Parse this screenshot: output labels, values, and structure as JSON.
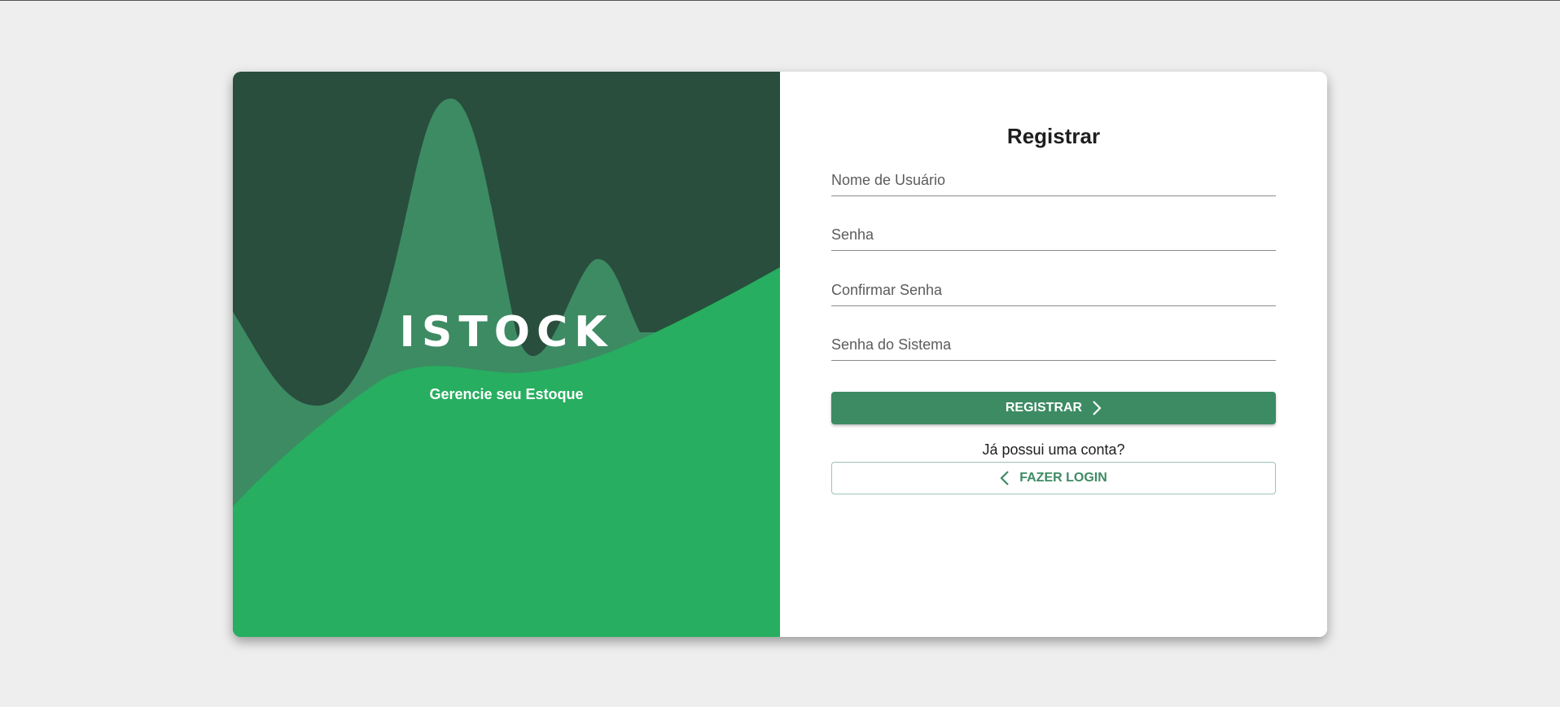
{
  "brand": {
    "name": "ISTOCK",
    "tagline": "Gerencie seu Estoque"
  },
  "form": {
    "title": "Registrar",
    "fields": [
      {
        "placeholder": "Nome de Usuário",
        "value": ""
      },
      {
        "placeholder": "Senha",
        "value": ""
      },
      {
        "placeholder": "Confirmar Senha",
        "value": ""
      },
      {
        "placeholder": "Senha do Sistema",
        "value": ""
      }
    ],
    "submit_label": "REGISTRAR",
    "have_account_text": "Já possui uma conta?",
    "login_label": "FAZER LOGIN"
  },
  "icons": {
    "submit": "chevron-right-icon",
    "login": "chevron-left-icon"
  },
  "colors": {
    "dark_green": "#294e3d",
    "mid_green": "#3d8b63",
    "bright_green": "#27ae60",
    "background": "#eeeeee"
  }
}
